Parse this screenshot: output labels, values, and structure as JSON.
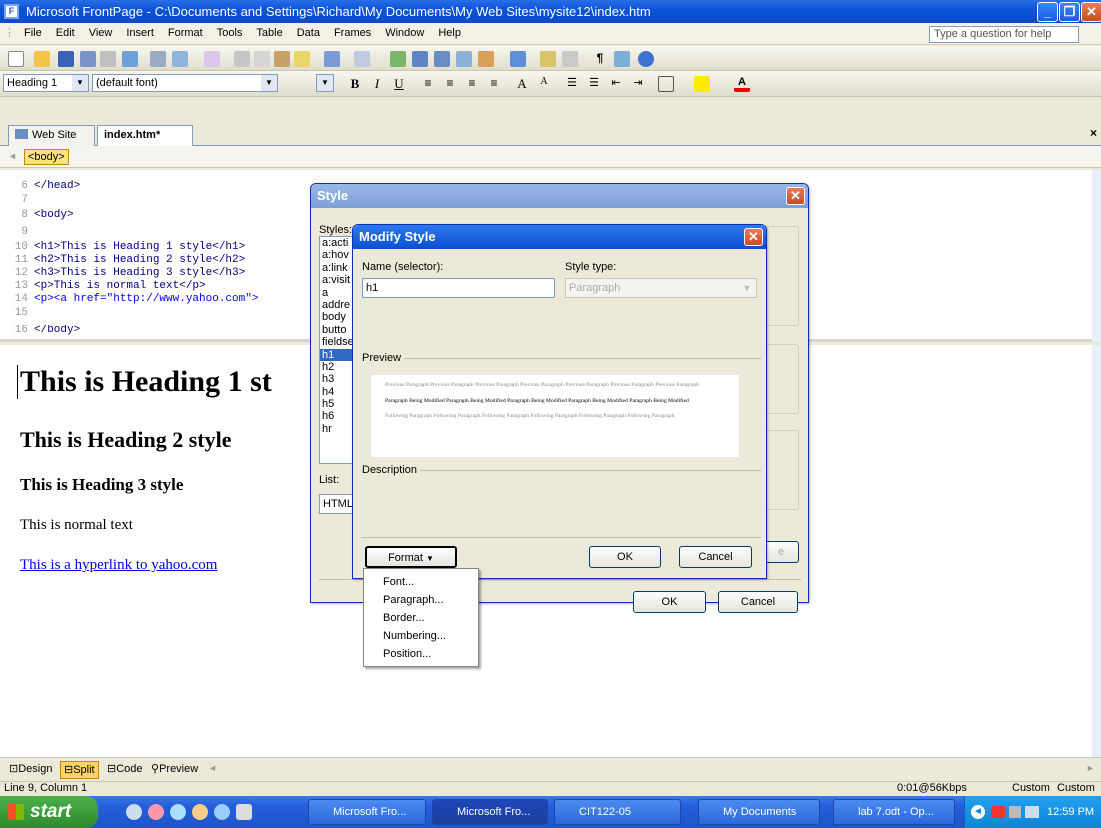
{
  "window": {
    "title": "Microsoft FrontPage - C:\\Documents and Settings\\Richard\\My Documents\\My Web Sites\\mysite12\\index.htm"
  },
  "menu": [
    "File",
    "Edit",
    "View",
    "Insert",
    "Format",
    "Tools",
    "Table",
    "Data",
    "Frames",
    "Window",
    "Help"
  ],
  "help_placeholder": "Type a question for help",
  "format_toolbar": {
    "style_value": "Heading 1",
    "font_value": "(default font)"
  },
  "tabs": {
    "website": "Web Site",
    "document": "index.htm*"
  },
  "tag_selector": "<body>",
  "code": [
    {
      "n": "6",
      "text": "</head>"
    },
    {
      "n": "7",
      "text": ""
    },
    {
      "n": "8",
      "text": "<body>"
    },
    {
      "n": "9",
      "text": ""
    },
    {
      "n": "10",
      "text": "<h1>This is Heading 1 style</h1>"
    },
    {
      "n": "11",
      "text": "<h2>This is Heading 2 style</h2>"
    },
    {
      "n": "12",
      "text": "<h3>This is Heading 3 style</h3>"
    },
    {
      "n": "13",
      "text": "<p>This is normal text</p>"
    },
    {
      "n": "14",
      "text": "<p><a href=\"http://www.yahoo.com\">"
    },
    {
      "n": "15",
      "text": ""
    },
    {
      "n": "16",
      "text": "</body>"
    }
  ],
  "design": {
    "h1": "This is Heading 1 st",
    "h2": "This is Heading 2 style",
    "h3": "This is Heading 3 style",
    "p": "This is normal text",
    "link": "This is a hyperlink to yahoo.com"
  },
  "style_dialog": {
    "title": "Style",
    "styles_label": "Styles:",
    "styles": [
      "a:acti",
      "a:hov",
      "a:link",
      "a:visit",
      "a",
      "addre",
      "body",
      "butto",
      "fieldse",
      "h1",
      "h2",
      "h3",
      "h4",
      "h5",
      "h6",
      "hr"
    ],
    "selected": "h1",
    "list_label": "List:",
    "list_value": "HTML",
    "ok": "OK",
    "cancel": "Cancel",
    "partial_button": "e"
  },
  "modify_dialog": {
    "title": "Modify Style",
    "name_label": "Name (selector):",
    "name_value": "h1",
    "type_label": "Style type:",
    "type_value": "Paragraph",
    "preview_label": "Preview",
    "preview_prev": "Previous Paragraph Previous Paragraph Previous Paragraph Previous Paragraph Previous Paragraph Previous Paragraph Previous Paragraph",
    "preview_mod": "Paragraph Being Modified Paragraph Being Modified Paragraph Being Modified Paragraph Being Modified Paragraph Being Modified",
    "preview_next": "Following Paragraph Following Paragraph Following Paragraph Following Paragraph Following Paragraph Following Paragraph",
    "description_label": "Description",
    "format_button": "Format",
    "ok": "OK",
    "cancel": "Cancel"
  },
  "format_menu": [
    "Font...",
    "Paragraph...",
    "Border...",
    "Numbering...",
    "Position..."
  ],
  "view_tabs": [
    "Design",
    "Split",
    "Code",
    "Preview"
  ],
  "status": {
    "position": "Line 9, Column 1",
    "speed": "0:01@56Kbps",
    "custom1": "Custom",
    "custom2": "Custom"
  },
  "taskbar": {
    "start": "start",
    "tasks": [
      "Microsoft Fro...",
      "Microsoft Fro...",
      "CIT122-05",
      "My Documents",
      "lab 7.odt - Op..."
    ],
    "clock": "12:59 PM"
  }
}
